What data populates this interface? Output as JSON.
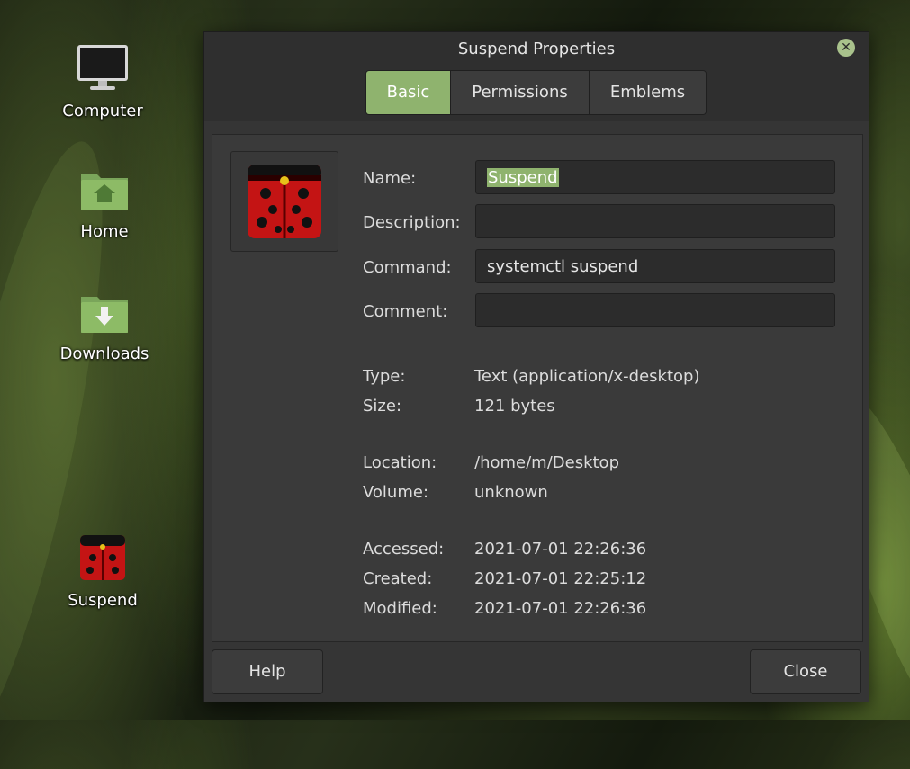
{
  "desktop": {
    "icons": [
      {
        "label": "Computer"
      },
      {
        "label": "Home"
      },
      {
        "label": "Downloads"
      },
      {
        "label": "Suspend"
      }
    ]
  },
  "dialog": {
    "title": "Suspend Properties",
    "tabs": [
      "Basic",
      "Permissions",
      "Emblems"
    ],
    "active_tab": "Basic",
    "fields": {
      "name_label": "Name:",
      "name_value": "Suspend",
      "description_label": "Description:",
      "description_value": "",
      "command_label": "Command:",
      "command_value": "systemctl suspend",
      "comment_label": "Comment:",
      "comment_value": ""
    },
    "info": {
      "type_label": "Type:",
      "type_value": "Text (application/x-desktop)",
      "size_label": "Size:",
      "size_value": "121 bytes",
      "location_label": "Location:",
      "location_value": "/home/m/Desktop",
      "volume_label": "Volume:",
      "volume_value": "unknown",
      "accessed_label": "Accessed:",
      "accessed_value": "2021-07-01 22:26:36",
      "created_label": "Created:",
      "created_value": "2021-07-01 22:25:12",
      "modified_label": "Modified:",
      "modified_value": "2021-07-01 22:26:36"
    },
    "buttons": {
      "help": "Help",
      "close": "Close"
    }
  },
  "colors": {
    "accent": "#8fb36e",
    "dialog_bg": "#353535"
  }
}
